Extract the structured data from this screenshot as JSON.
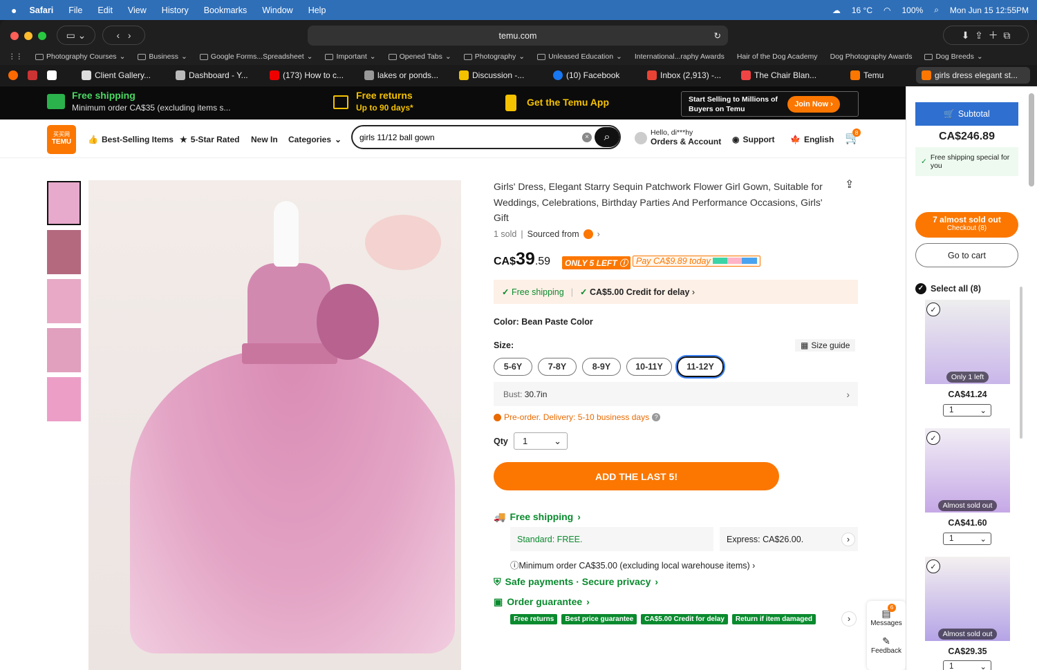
{
  "menubar": {
    "items": [
      "Safari",
      "File",
      "Edit",
      "View",
      "History",
      "Bookmarks",
      "Window",
      "Help"
    ],
    "temp": "16 °C",
    "battery": "100%",
    "datetime": "Mon Jun 15  12:55PM"
  },
  "browser": {
    "url": "temu.com"
  },
  "bookmarks": [
    "Photography Courses",
    "Business",
    "Google Forms...Spreadsheet",
    "Important",
    "Opened Tabs",
    "Photography",
    "Unleased Education",
    "International...raphy Awards",
    "Hair of the Dog Academy",
    "Dog Photography Awards",
    "Dog Breeds"
  ],
  "tabs": [
    "Client Gallery...",
    "Dashboard - Y...",
    "(173) How to c...",
    "lakes or ponds...",
    "Discussion -...",
    "(10) Facebook",
    "Inbox (2,913) -...",
    "The Chair Blan...",
    "Temu",
    "girls dress elegant st..."
  ],
  "promo": {
    "free_shipping": "Free shipping",
    "free_shipping_sub": "Minimum order CA$35 (excluding items s...",
    "free_returns": "Free returns",
    "free_returns_sub": "Up to 90 days*",
    "app": "Get the Temu App",
    "sell_line1": "Start Selling to Millions of",
    "sell_line2": "Buyers on Temu",
    "join": "Join Now"
  },
  "header": {
    "logo_top": "买买网",
    "logo": "TEMU",
    "nav": [
      "Best-Selling Items",
      "5-Star Rated",
      "New In",
      "Categories"
    ],
    "search_value": "girls 11/12 ball gown",
    "hello": "Hello, di***hy",
    "account": "Orders & Account",
    "support": "Support",
    "language": "English",
    "cart_count": "8"
  },
  "product": {
    "title": "Girls' Dress, Elegant Starry Sequin Patchwork Flower Girl Gown, Suitable for Weddings, Celebrations, Birthday Parties And Performance Occasions, Girls' Gift",
    "sold": "1 sold",
    "sourced": "Sourced from",
    "price_prefix": "CA$",
    "price_main": "39",
    "price_cents": ".59",
    "only_left": "ONLY 5 LEFT",
    "pay_today": "Pay CA$9.89 today",
    "free_shipping": "Free shipping",
    "credit": "CA$5.00 Credit for delay",
    "color_label": "Color: Bean Paste Color",
    "size_label": "Size:",
    "size_guide": "Size guide",
    "sizes": [
      "5-6Y",
      "7-8Y",
      "8-9Y",
      "10-11Y",
      "11-12Y"
    ],
    "bust_label": "Bust:",
    "bust": "30.7in",
    "preorder": "Pre-order. Delivery: 5-10 business days",
    "qty_label": "Qty",
    "qty": "1",
    "add_button": "ADD THE LAST 5!",
    "ship_title": "Free shipping",
    "standard": "Standard: FREE.",
    "express": "Express: CA$26.00.",
    "min_order": "Minimum order CA$35.00 (excluding local warehouse items)",
    "safe": "Safe payments · Secure privacy",
    "guarantee": "Order guarantee",
    "tags": [
      "Free returns",
      "Best price guarantee",
      "CA$5.00 Credit for delay",
      "Return if item damaged"
    ],
    "messages": "Messages",
    "messages_count": "6",
    "feedback": "Feedback"
  },
  "cart": {
    "subtotal_label": "Subtotal",
    "subtotal": "CA$246.89",
    "free_ship": "Free shipping special for you",
    "checkout_line1": "7 almost sold out",
    "checkout_line2": "Checkout (8)",
    "go_cart": "Go to cart",
    "select_all": "Select all (8)",
    "items": [
      {
        "badge": "Only 1 left",
        "price": "CA$41.24",
        "qty": "1"
      },
      {
        "badge": "Almost sold out",
        "price": "CA$41.60",
        "qty": "1"
      },
      {
        "badge": "Almost sold out",
        "price": "CA$29.35",
        "qty": "1"
      }
    ]
  },
  "colors": {
    "accent": "#fb7701",
    "green": "#0a8a2e",
    "promo_bg": "#0b0b0b"
  }
}
